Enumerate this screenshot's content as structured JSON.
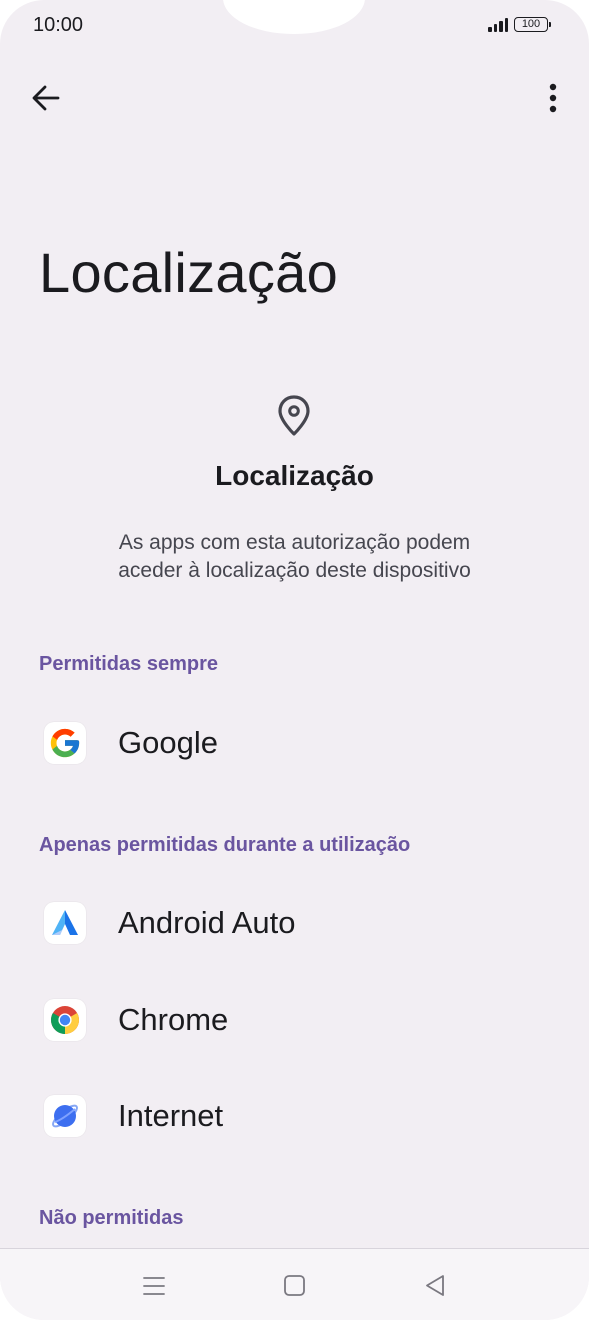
{
  "status_bar": {
    "time": "10:00",
    "battery": "100"
  },
  "header": {
    "back_icon": "arrow-left-icon",
    "more_icon": "more-vert-icon"
  },
  "page": {
    "title": "Localização",
    "permission_icon": "location-pin-icon",
    "permission_title": "Localização",
    "description_line1": "As apps com esta autorização podem",
    "description_line2": "aceder à localização deste dispositivo"
  },
  "sections": [
    {
      "heading": "Permitidas sempre",
      "apps": [
        {
          "name": "Google",
          "icon": "google-icon"
        }
      ]
    },
    {
      "heading": "Apenas permitidas durante a utilização",
      "apps": [
        {
          "name": "Android Auto",
          "icon": "android-auto-icon"
        },
        {
          "name": "Chrome",
          "icon": "chrome-icon"
        },
        {
          "name": "Internet",
          "icon": "internet-icon"
        }
      ]
    },
    {
      "heading": "Não permitidas",
      "apps": []
    }
  ],
  "nav_bar": {
    "recents_icon": "menu-icon",
    "home_icon": "home-square-icon",
    "back_icon": "back-triangle-icon"
  },
  "colors": {
    "background": "#f2eef3",
    "accent": "#6a55a0",
    "text": "#1b1b1f"
  }
}
